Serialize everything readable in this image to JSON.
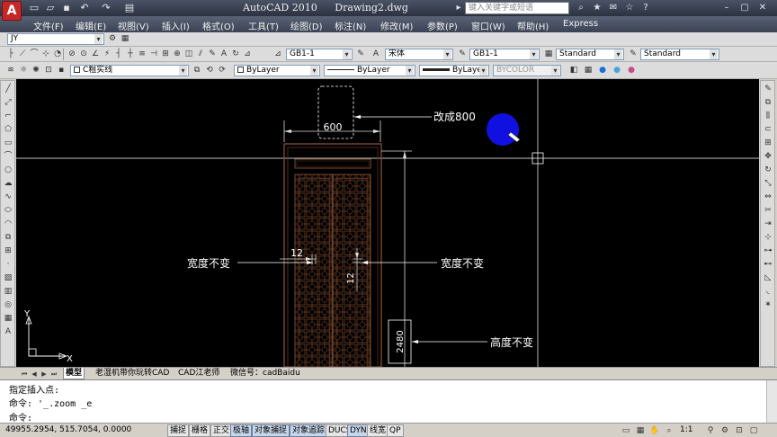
{
  "window": {
    "app_name": "AutoCAD 2010",
    "document": "Drawing2.dwg",
    "search_placeholder": "键入关键字或短语"
  },
  "menu": [
    "文件(F)",
    "编辑(E)",
    "视图(V)",
    "插入(I)",
    "格式(O)",
    "工具(T)",
    "绘图(D)",
    "标注(N)",
    "修改(M)",
    "参数(P)",
    "窗口(W)",
    "帮助(H)",
    "Express"
  ],
  "toolbar": {
    "workspace": "JY",
    "dim_style": "GB1-1",
    "text_font": "宋体",
    "table_style": "GB1-1",
    "multileader_style": "Standard",
    "text_style": "Standard",
    "layer": "C粗实线",
    "color": "ByLayer",
    "linetype": "ByLayer",
    "lineweight": "ByLayer",
    "plot_style": "BYCOLOR"
  },
  "drawing": {
    "dim_top": "600",
    "note_top": "改成800",
    "dim_mid": "12",
    "dim_mid_v": "12",
    "note_left": "宽度不变",
    "note_right": "宽度不变",
    "dim_height": "2480",
    "note_height": "高度不变",
    "ucs_x": "X",
    "ucs_y": "Y"
  },
  "tabs": [
    "模型",
    "老湿机带你玩转CAD",
    "CAD江老师",
    "微信号：cadBaidu"
  ],
  "command": {
    "line1": "指定插入点:",
    "line2": "命令: '_.zoom _e",
    "prompt": "命令:"
  },
  "status": {
    "coords": "49955.2954, 515.7054, 0.0000",
    "buttons": [
      "捕捉",
      "栅格",
      "正交",
      "极轴",
      "对象捕捉",
      "对象追踪",
      "DUCS",
      "DYN",
      "线宽",
      "QP"
    ],
    "scale": "1:1"
  }
}
